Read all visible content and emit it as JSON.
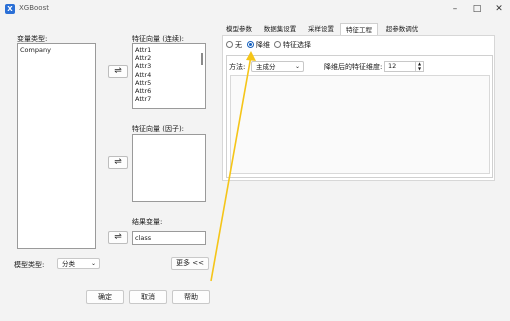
{
  "window": {
    "title": "XGBoost",
    "app_icon": "X"
  },
  "left": {
    "var_type_label": "变量类型:",
    "var_list": [
      "Company"
    ],
    "feature_cont_label": "特征向量 (连续):",
    "feature_cont_list": [
      "Attr1",
      "Attr2",
      "Attr3",
      "Attr4",
      "Attr5",
      "Attr6",
      "Attr7"
    ],
    "feature_factor_label": "特征向量 (因子):",
    "target_label": "结果变量:",
    "target_value": "class",
    "model_type_label": "模型类型:",
    "model_type_value": "分类",
    "more_button": "更多 <<",
    "ok_button": "确定",
    "cancel_button": "取消",
    "help_button": "帮助",
    "swap_glyph": "⇌"
  },
  "tabs": [
    "模型参数",
    "数据集设置",
    "采样设置",
    "特征工程",
    "超参数调优"
  ],
  "active_tab": 3,
  "feature_eng": {
    "radio_none": "无",
    "radio_reduce": "降维",
    "radio_select": "特征选择",
    "selected": "降维",
    "method_label": "方法:",
    "method_value": "主成分",
    "dim_label": "降维后的特征维度:",
    "dim_value": "12"
  },
  "colors": {
    "accent": "#1560bd",
    "annotation_arrow": "#f5c518"
  }
}
